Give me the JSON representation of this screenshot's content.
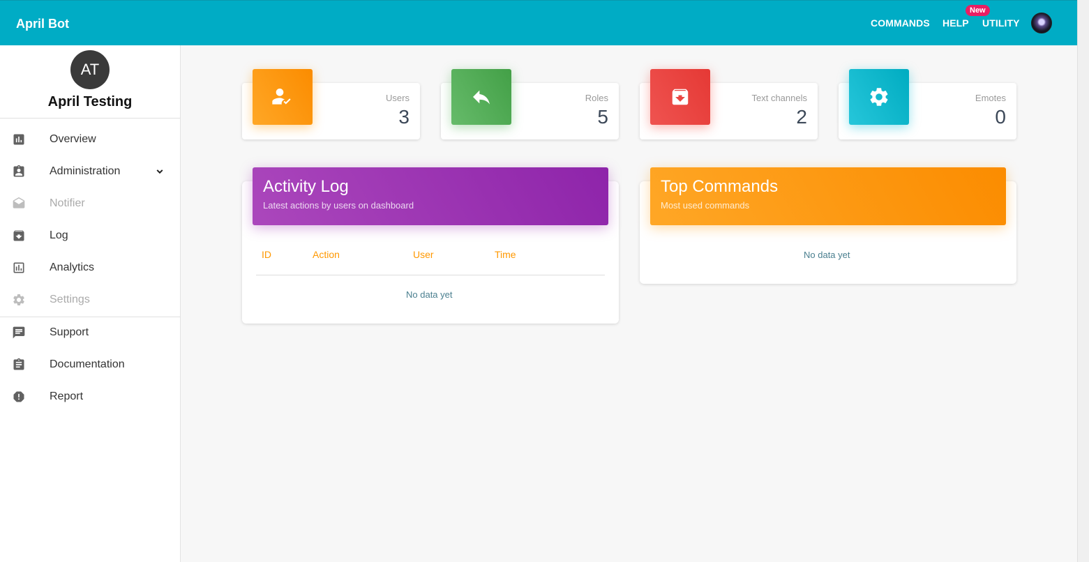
{
  "topbar": {
    "brand": "April Bot",
    "nav": [
      "COMMANDS",
      "HELP",
      "UTILITY"
    ],
    "badge": "New",
    "bg_color": "#00acc5"
  },
  "sidebar": {
    "avatar_initials": "AT",
    "profile_name": "April Testing",
    "items": [
      {
        "label": "Overview",
        "icon": "chart-icon"
      },
      {
        "label": "Administration",
        "icon": "clipboard-user-icon"
      },
      {
        "label": "Notifier",
        "icon": "envelope-icon"
      },
      {
        "label": "Log",
        "icon": "archive-icon"
      },
      {
        "label": "Analytics",
        "icon": "analytics-icon"
      },
      {
        "label": "Settings",
        "icon": "gear-icon"
      },
      {
        "label": "Support",
        "icon": "chat-icon"
      },
      {
        "label": "Documentation",
        "icon": "document-icon"
      },
      {
        "label": "Report",
        "icon": "alert-icon"
      }
    ]
  },
  "stats": [
    {
      "label": "Users",
      "value": "3",
      "color": "#ff9800"
    },
    {
      "label": "Roles",
      "value": "5",
      "color": "#4caf50"
    },
    {
      "label": "Text channels",
      "value": "2",
      "color": "#f44336"
    },
    {
      "label": "Emotes",
      "value": "0",
      "color": "#00bcd4"
    }
  ],
  "activity_log": {
    "title": "Activity Log",
    "subtitle": "Latest actions by users on dashboard",
    "columns": [
      "ID",
      "Action",
      "User",
      "Time"
    ],
    "empty": "No data yet"
  },
  "top_commands": {
    "title": "Top Commands",
    "subtitle": "Most used commands",
    "empty": "No data yet"
  }
}
